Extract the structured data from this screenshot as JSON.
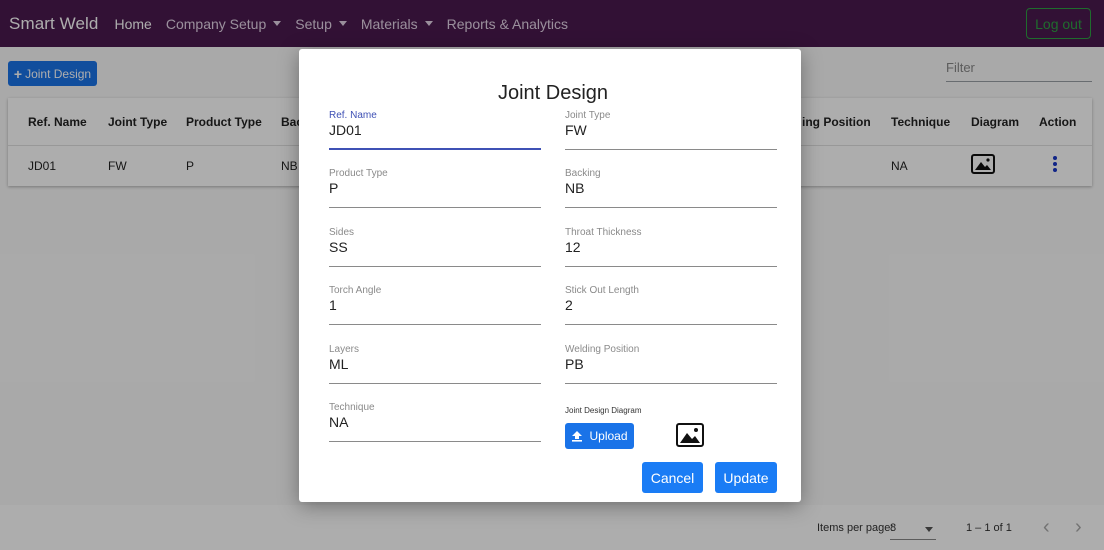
{
  "navbar": {
    "brand": "Smart Weld",
    "links": [
      {
        "label": "Home",
        "active": true,
        "dropdown": false
      },
      {
        "label": "Company Setup",
        "active": false,
        "dropdown": true
      },
      {
        "label": "Setup",
        "active": false,
        "dropdown": true
      },
      {
        "label": "Materials",
        "active": false,
        "dropdown": true
      },
      {
        "label": "Reports & Analytics",
        "active": false,
        "dropdown": false
      }
    ],
    "logout_label": "Log out"
  },
  "toolbar": {
    "add_icon": "plus-icon",
    "add_label": "Joint Design",
    "filter_placeholder": "Filter"
  },
  "table": {
    "headers": [
      "Ref. Name",
      "Joint Type",
      "Product Type",
      "Bac",
      "ing Position",
      "Technique",
      "Diagram",
      "Action"
    ],
    "rows": [
      {
        "ref_name": "JD01",
        "joint_type": "FW",
        "product_type": "P",
        "backing": "NB",
        "technique": "NA",
        "diagram_icon": "image-icon",
        "action_icon": "more-vert-icon"
      }
    ]
  },
  "paginator": {
    "items_per_page_label": "Items per page:",
    "page_size": "8",
    "range": "1 – 1 of 1",
    "prev_icon": "chevron-left-icon",
    "next_icon": "chevron-right-icon"
  },
  "modal": {
    "title": "Joint Design",
    "fields": {
      "ref_name": {
        "label": "Ref. Name",
        "value": "JD01"
      },
      "joint_type": {
        "label": "Joint Type",
        "value": "FW"
      },
      "product_type": {
        "label": "Product Type",
        "value": "P"
      },
      "backing": {
        "label": "Backing",
        "value": "NB"
      },
      "sides": {
        "label": "Sides",
        "value": "SS"
      },
      "throat_thickness": {
        "label": "Throat Thickness",
        "value": "12"
      },
      "torch_angle": {
        "label": "Torch Angle",
        "value": "1"
      },
      "stick_out_length": {
        "label": "Stick Out Length",
        "value": "2"
      },
      "layers": {
        "label": "Layers",
        "value": "ML"
      },
      "welding_position": {
        "label": "Welding Position",
        "value": "PB"
      },
      "technique": {
        "label": "Technique",
        "value": "NA"
      }
    },
    "diagram_label": "Joint Design Diagram",
    "upload_label": "Upload",
    "cancel_label": "Cancel",
    "update_label": "Update"
  },
  "colors": {
    "navbar_bg": "#4a1a4f",
    "primary": "#1a73e8",
    "logout": "#2ea043",
    "focus": "#3f51b5"
  }
}
